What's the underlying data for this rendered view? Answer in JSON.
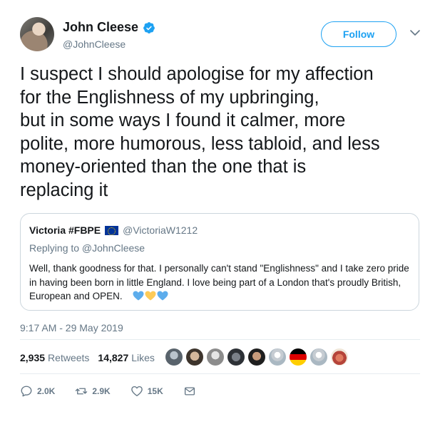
{
  "author": {
    "display_name": "John Cleese",
    "handle": "@JohnCleese",
    "verified_icon": "verified-badge-icon",
    "follow_label": "Follow"
  },
  "tweet": {
    "text": "I suspect I should apologise for my affection\nfor the Englishness of my upbringing,\nbut in some ways I found it calmer, more\npolite, more humorous, less tabloid, and less\nmoney-oriented than the one that is\nreplacing it",
    "timestamp": "9:17 AM - 29 May 2019"
  },
  "quoted_tweet": {
    "display_name": "Victoria #FBPE",
    "flag_icon": "eu-flag-icon",
    "handle": "@VictoriaW1212",
    "replying_to": "Replying to @JohnCleese",
    "text": "Well, thank goodness for that. I personally can't stand \"Englishness\" and I take zero pride in having been born in little England. I love being part of a London that's proudly British, European and OPEN.",
    "emoji": [
      "blue-heart-icon",
      "yellow-heart-icon",
      "blue-heart-icon"
    ]
  },
  "stats": {
    "retweets_count": "2,935",
    "retweets_label": "Retweets",
    "likes_count": "14,827",
    "likes_label": "Likes"
  },
  "liker_avatars": [
    "avatar-1",
    "avatar-2",
    "avatar-3",
    "avatar-4",
    "avatar-5",
    "avatar-6",
    "avatar-7",
    "avatar-8",
    "avatar-9"
  ],
  "actions": {
    "replies": "2.0K",
    "retweets": "2.9K",
    "likes": "15K"
  },
  "colors": {
    "accent": "#1da1f2",
    "muted": "#657786",
    "text": "#14171a",
    "border": "#ccd6dd"
  }
}
